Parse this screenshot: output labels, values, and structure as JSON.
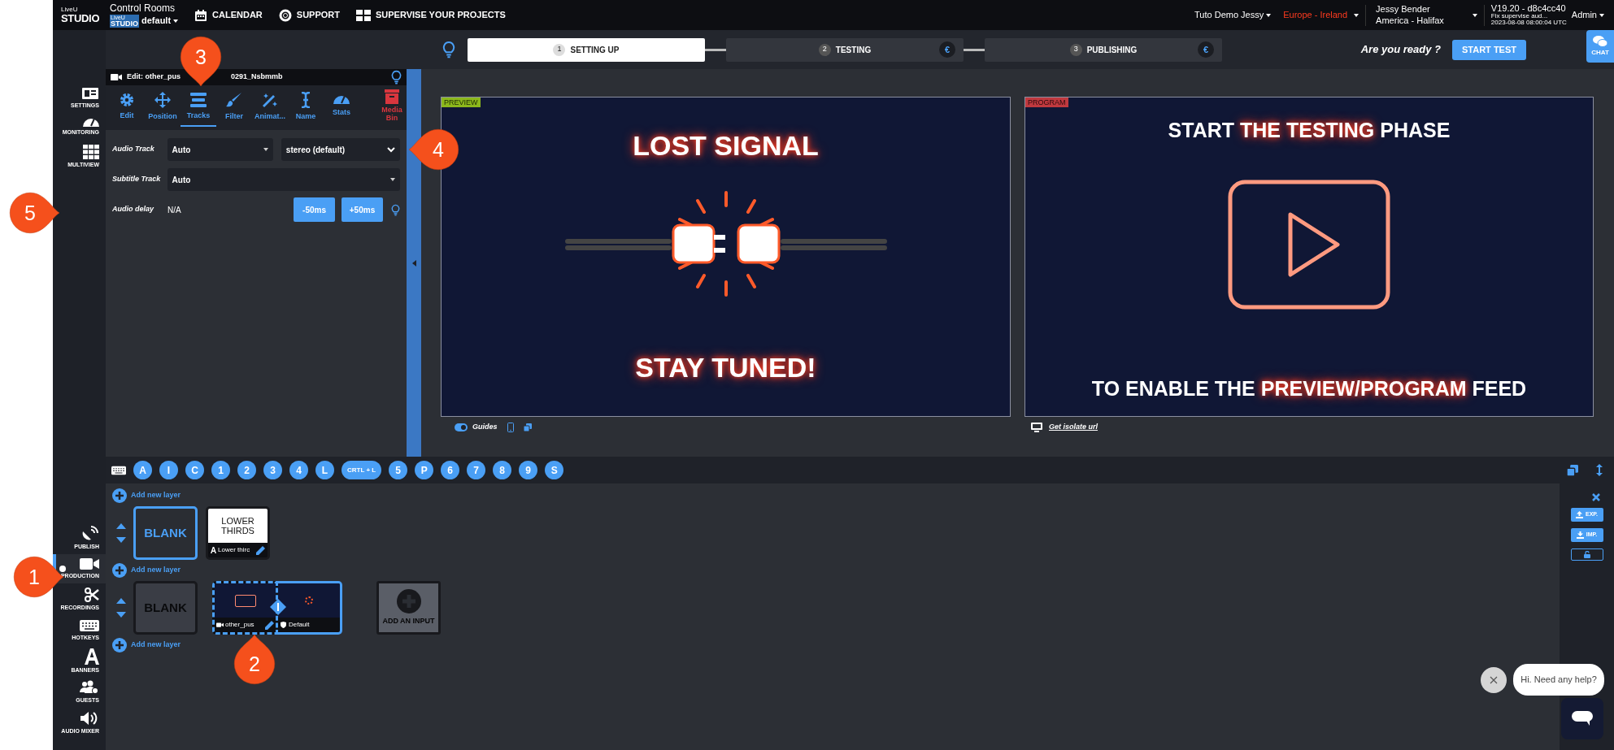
{
  "top_bar": {
    "logo": [
      "LiveU",
      "STUDIO"
    ],
    "room_title": "Control Rooms",
    "room_logo": [
      "LiveU",
      "STUDIO"
    ],
    "room_name": "default",
    "nav": [
      {
        "kind": "calendar",
        "label": "CALENDAR"
      },
      {
        "kind": "support",
        "label": "SUPPORT"
      },
      {
        "kind": "supervise",
        "label": "SUPERVISE YOUR PROJECTS"
      }
    ],
    "account": "Tuto Demo Jessy",
    "region": "Europe - Ireland",
    "user": {
      "name": "Jessy Bender",
      "timezone": "America - Halifax"
    },
    "version": {
      "number": "V19.20 - d8c4cc40",
      "note": "Fix supervise aud...",
      "date": "2023-08-08 08:00:04 UTC"
    },
    "role": "Admin"
  },
  "stepper": {
    "steps": [
      {
        "number": "1",
        "label": "SETTING UP",
        "selected": true
      },
      {
        "number": "2",
        "label": "TESTING",
        "selected": false,
        "badge": "€"
      },
      {
        "number": "3",
        "label": "PUBLISHING",
        "selected": false,
        "badge": "€"
      }
    ],
    "prompt": "Are you ready ?",
    "action": "START TEST",
    "chat": "CHAT"
  },
  "sidebar": {
    "top": [
      {
        "kind": "settings",
        "label": "SETTINGS",
        "selected": false
      },
      {
        "kind": "monitoring",
        "label": "MONITORING",
        "selected": false
      },
      {
        "kind": "multiview",
        "label": "MULTIVIEW",
        "selected": false
      }
    ],
    "bottom": [
      {
        "kind": "publish",
        "label": "PUBLISH",
        "selected": false
      },
      {
        "kind": "production",
        "label": "PRODUCTION",
        "selected": true
      },
      {
        "kind": "recordings",
        "label": "RECORDINGS",
        "selected": false
      },
      {
        "kind": "hotkeys",
        "label": "HOTKEYS",
        "selected": false
      },
      {
        "kind": "banners",
        "label": "BANNERS",
        "selected": false
      },
      {
        "kind": "guests",
        "label": "GUESTS",
        "selected": false
      },
      {
        "kind": "audio",
        "label": "AUDIO MIXER",
        "selected": false
      }
    ]
  },
  "edit_panel": {
    "title_parts": [
      "Edit: other_pus",
      "0291_Nsbmmb"
    ],
    "tabs": [
      {
        "kind": "edit",
        "label": "Edit",
        "selected": false
      },
      {
        "kind": "position",
        "label": "Position",
        "selected": false
      },
      {
        "kind": "tracks",
        "label": "Tracks",
        "selected": true
      },
      {
        "kind": "filter",
        "label": "Filter",
        "selected": false
      },
      {
        "kind": "animate",
        "label": "Animat...",
        "selected": false
      },
      {
        "kind": "name",
        "label": "Name",
        "selected": false
      },
      {
        "kind": "stats",
        "label": "Stats",
        "selected": false
      }
    ],
    "media_bin": "Media Bin",
    "rows": [
      {
        "kind": "selects",
        "label": "Audio Track",
        "selects": [
          "Auto",
          "stereo (default)"
        ]
      },
      {
        "kind": "selects",
        "label": "Subtitle Track",
        "selects": [
          "Auto"
        ]
      },
      {
        "kind": "delay",
        "label": "Audio delay",
        "value": "N/A",
        "buttons": [
          "-50ms",
          "+50ms"
        ]
      }
    ]
  },
  "preview": {
    "badge": "PREVIEW",
    "headline": "LOST SIGNAL",
    "footer": "STAY TUNED!",
    "guides": {
      "label": "Guides",
      "on": true
    }
  },
  "program": {
    "badge": "PROGRAM",
    "headline": "START **THE TESTING** PHASE",
    "footer": "TO ENABLE THE **PREVIEW/PROGRAM** FEED",
    "link": "Get isolate url"
  },
  "hotkeys": [
    "A",
    "I",
    "C",
    "1",
    "2",
    "3",
    "4",
    "L",
    "CRTL + L",
    "5",
    "P",
    "6",
    "7",
    "8",
    "9",
    "S"
  ],
  "layers": {
    "add_labels": [
      "Add new layer",
      "Add new layer",
      "Add new layer"
    ],
    "rows": [
      {
        "cards": [
          {
            "kind": "blank",
            "label": "BLANK",
            "active": true
          },
          {
            "kind": "graphic",
            "title": "LOWER THIRDS",
            "caption": "Lower thirc"
          }
        ]
      },
      {
        "cards": [
          {
            "kind": "blank",
            "label": "BLANK",
            "active": false
          },
          {
            "kind": "input",
            "caption": "other_pus",
            "scene": "Default"
          },
          {
            "kind": "add",
            "label": "ADD AN INPUT"
          }
        ]
      }
    ]
  },
  "side_actions": [
    "EXP.",
    "IMP."
  ],
  "chat_widget": {
    "message": "Hi. Need any help?"
  },
  "annotations": [
    {
      "number": "1"
    },
    {
      "number": "2"
    },
    {
      "number": "3"
    },
    {
      "number": "4"
    },
    {
      "number": "5"
    }
  ]
}
